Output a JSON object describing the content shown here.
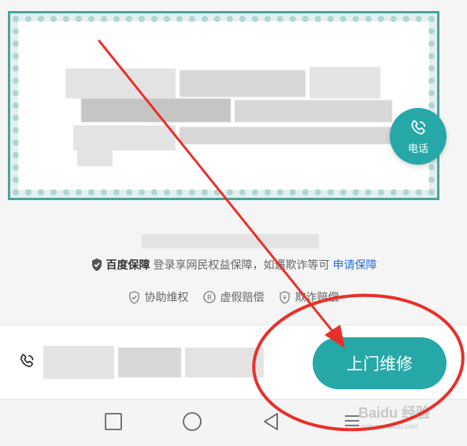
{
  "fab": {
    "label": "电话"
  },
  "guarantee": {
    "brand": "百度保障",
    "text": "登录享网民权益保障，如遇欺诈等可",
    "link": "申请保障"
  },
  "perks": [
    {
      "label": "协助维权",
      "icon": "shield-check-icon"
    },
    {
      "label": "虚假赔偿",
      "icon": "registered-icon"
    },
    {
      "label": "欺诈赔偿",
      "icon": "yuan-shield-icon"
    }
  ],
  "bottom_bar": {
    "action_label": "上门维修"
  },
  "watermark": {
    "text": "Baidu 经验",
    "sub": "jingyan.baidu.com"
  },
  "colors": {
    "accent": "#27a8a8",
    "link": "#2b6fd6",
    "annotation": "#e8302a"
  }
}
